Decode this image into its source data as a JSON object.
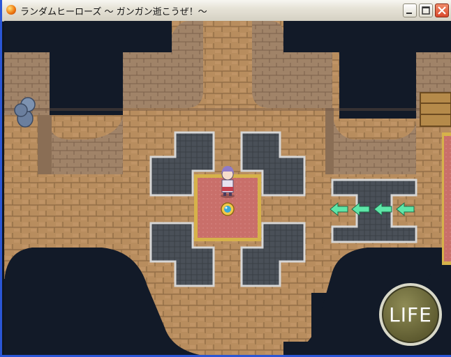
{
  "window": {
    "title": "ランダムヒーローズ ～ ガンガン逝こうぜ！～",
    "app_icon": "orange-orb-icon",
    "buttons": {
      "minimize": "minimize-icon",
      "maximize": "maximize-icon",
      "close": "close-icon"
    }
  },
  "hud": {
    "life_label": "LIFE"
  },
  "scene": {
    "floor_color": "#b88d5e",
    "wall_color": "#a08368",
    "pit_color": "#4a5058",
    "void_color": "#121a28",
    "carpet_color": "#c96f6a",
    "arrow_color": "#5ee6a8",
    "arrow_direction": "left",
    "arrow_count": 4,
    "objects": [
      "player-character",
      "save-orb",
      "blue-pots",
      "wooden-crate",
      "direction-arrows"
    ]
  }
}
